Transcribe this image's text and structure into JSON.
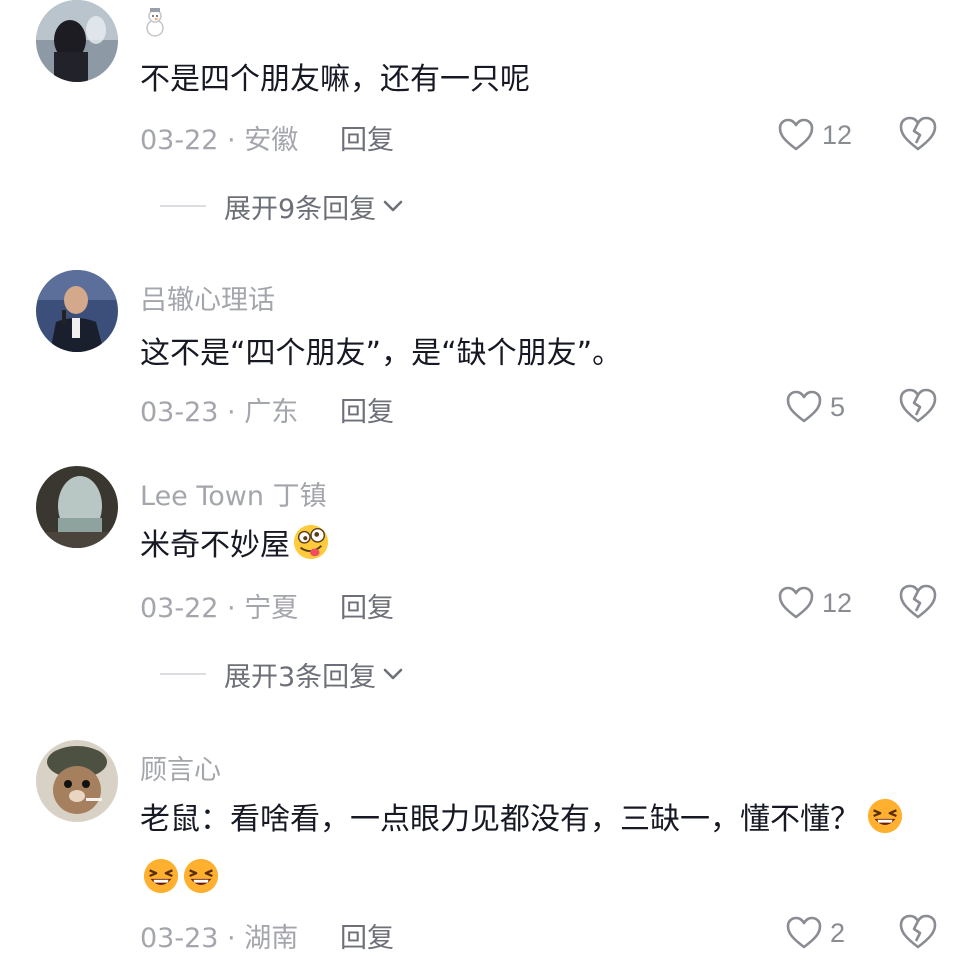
{
  "comments": [
    {
      "username": "☃",
      "text": "不是四个朋友嘛，还有一只呢",
      "date_location": "03-22 · 安徽",
      "reply_label": "回复",
      "likes": "12",
      "expand_label": "展开9条回复"
    },
    {
      "username": "吕辙心理话",
      "text": "这不是“四个朋友”，是“缺个朋友”。",
      "date_location": "03-23 · 广东",
      "reply_label": "回复",
      "likes": "5"
    },
    {
      "username": "Lee Town 丁镇",
      "text": "米奇不妙屋",
      "date_location": "03-22 · 宁夏",
      "reply_label": "回复",
      "likes": "12",
      "expand_label": "展开3条回复",
      "emoji": "crazy-face-emoji"
    },
    {
      "username": "顾言心",
      "text": "老鼠：看啥看，一点眼力见都没有，三缺一，懂不懂？",
      "date_location": "03-23 · 湖南",
      "reply_label": "回复",
      "likes": "2",
      "emoji": "laughing-face-emoji"
    }
  ],
  "icons": {
    "like": "heart-outline-icon",
    "dislike": "broken-heart-icon",
    "expand": "chevron-down-icon"
  },
  "colors": {
    "text": "#161823",
    "secondary": "#a4a6ad",
    "reply": "#6e7079",
    "icon": "#8a8c93"
  }
}
